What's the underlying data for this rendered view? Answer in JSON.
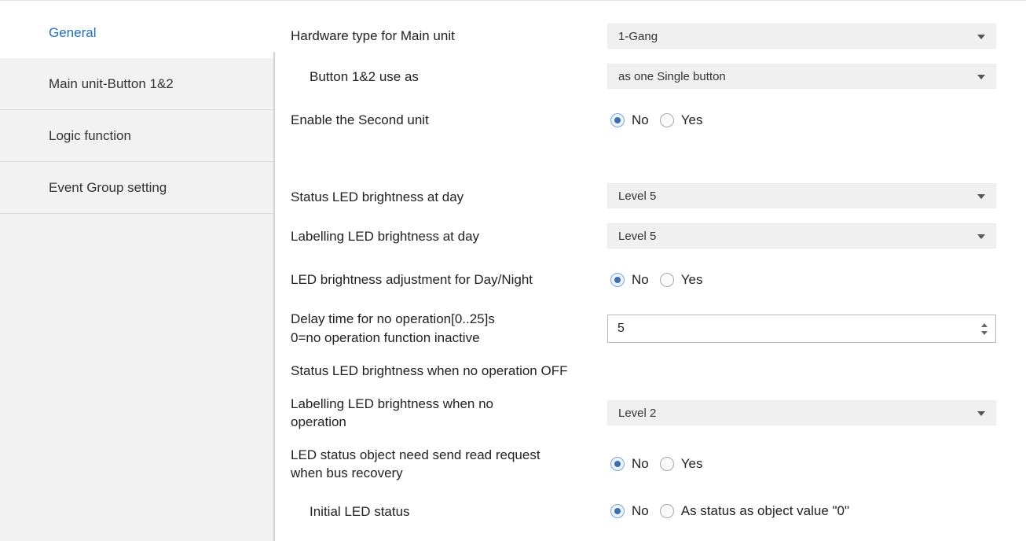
{
  "sidebar": {
    "items": [
      {
        "label": "General"
      },
      {
        "label": "Main unit-Button 1&2"
      },
      {
        "label": "Logic function"
      },
      {
        "label": "Event Group setting"
      }
    ]
  },
  "settings": {
    "hardware_type": {
      "label": "Hardware type for Main unit",
      "value": "1-Gang"
    },
    "button_use": {
      "label": "Button 1&2 use as",
      "value": "as one Single button"
    },
    "enable_second": {
      "label": "Enable the Second unit",
      "options": [
        "No",
        "Yes"
      ],
      "selected": "No"
    },
    "status_led_day": {
      "label": "Status LED brightness at day",
      "value": "Level 5"
    },
    "labelling_led_day": {
      "label": "Labelling LED brightness at day",
      "value": "Level 5"
    },
    "led_adjust": {
      "label": "LED brightness adjustment for Day/Night",
      "options": [
        "No",
        "Yes"
      ],
      "selected": "No"
    },
    "delay_time": {
      "label_line1": "Delay time for no operation[0..25]s",
      "label_line2": "0=no operation function inactive",
      "value": "5"
    },
    "status_led_noop": {
      "label": "Status LED brightness when no operation OFF"
    },
    "labelling_led_noop": {
      "label_line1": "Labelling LED brightness when no",
      "label_line2": "operation",
      "value": "Level 2"
    },
    "led_status_read": {
      "label_line1": "LED status object need send read request",
      "label_line2": "when bus recovery",
      "options": [
        "No",
        "Yes"
      ],
      "selected": "No"
    },
    "initial_led": {
      "label": "Initial LED status",
      "options": [
        "No",
        "As status as object value \"0\""
      ],
      "selected": "No"
    }
  }
}
